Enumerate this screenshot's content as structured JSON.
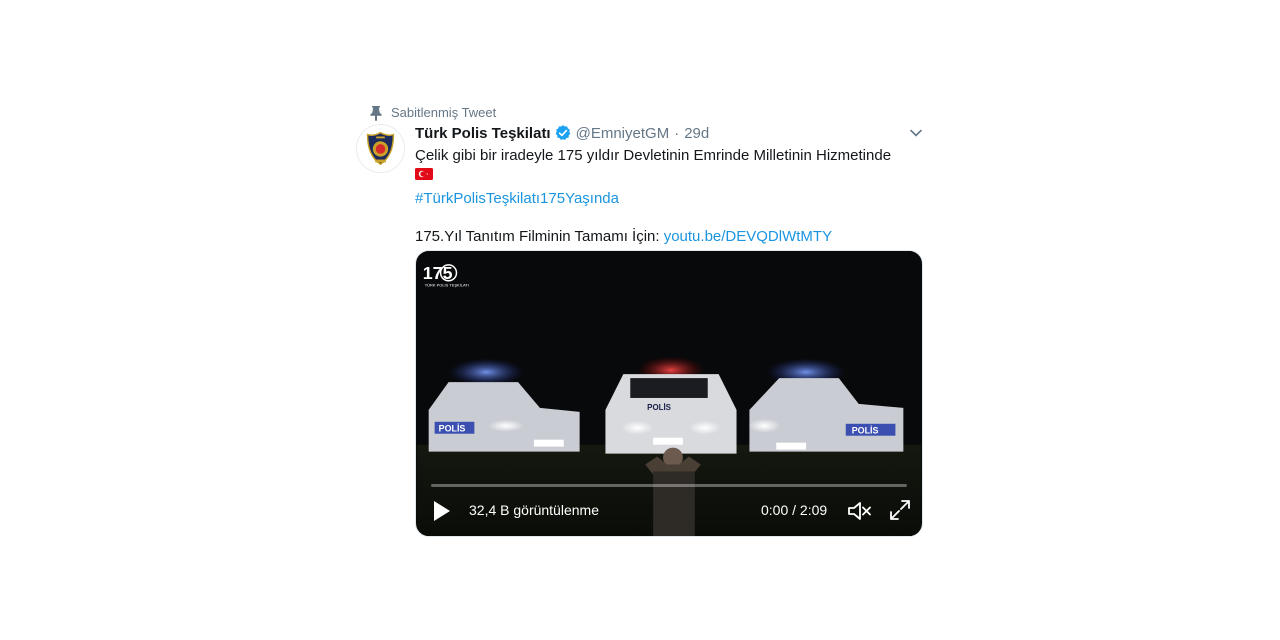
{
  "pinned": {
    "label": "Sabitlenmiş Tweet",
    "icon": "pin-icon"
  },
  "author": {
    "name": "Türk Polis Teşkilatı",
    "handle": "@EmniyetGM",
    "time": "29d",
    "verified": true
  },
  "tweet": {
    "text_line1": "Çelik gibi bir iradeyle 175 yıldır Devletinin Emrinde Milletinin Hizmetinde",
    "flag_icon": "turkey-flag-icon",
    "hashtag": "#TürkPolisTeşkilatı175Yaşında",
    "promo_text": "175.Yıl Tanıtım Filminin Tamamı İçin: ",
    "link": "youtu.be/DEVQDlWtMTY"
  },
  "video": {
    "views": "32,4 B görüntülenme",
    "timecode": "0:00 / 2:09",
    "progress": 0,
    "logo_number": "175",
    "logo_text": "TÜRK POLİS TEŞKİLATI",
    "car_label": "POLİS"
  },
  "colors": {
    "link": "#1b95e0",
    "secondary": "#657786",
    "verified": "#1da1f2"
  }
}
